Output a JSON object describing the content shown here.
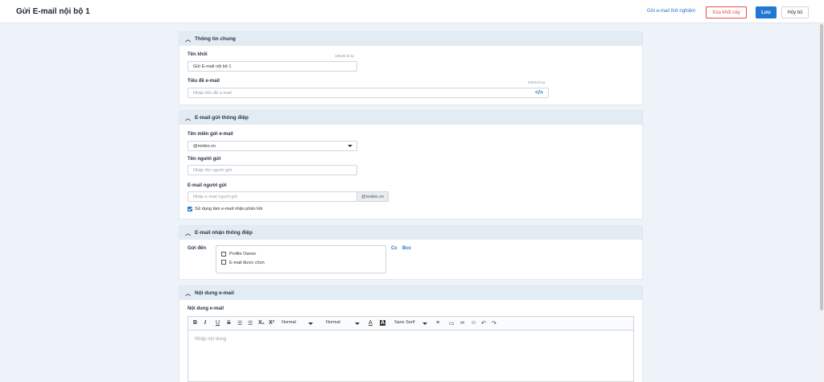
{
  "header": {
    "title": "Gửi E-mail nội bộ 1",
    "test_link": "Gửi e-mail thử nghiệm",
    "delete_label": "Xóa khối này",
    "save_label": "Lưu",
    "cancel_label": "Hủy bỏ"
  },
  "general": {
    "title": "Thông tin chung",
    "name_label": "Tên khối",
    "name_counter": "19/100 kí tự",
    "name_value": "Gửi E-mail nội bộ 1",
    "subject_label": "Tiêu đề e-mail",
    "subject_counter": "0/200 kí tự",
    "subject_placeholder": "Nhập tiêu đề e-mail",
    "code_icon": "</>"
  },
  "sender": {
    "title": "E-mail gửi thông điệp",
    "domain_label": "Tên miền gửi e-mail",
    "domain_value": "@mobio.vn",
    "sender_name_label": "Tên người gửi",
    "sender_name_placeholder": "Nhập tên người gửi",
    "sender_email_label": "E-mail người gửi",
    "sender_email_placeholder": "Nhập e-mail người gửi",
    "sender_email_suffix": "@mobio.vn",
    "reply_label": "Sử dụng làm e-mail nhận phản hồi",
    "reply_checked": true
  },
  "recipient": {
    "title": "E-mail nhận thông điệp",
    "send_to_label": "Gửi đến",
    "options": [
      "Profile Owner",
      "E-mail được chọn"
    ],
    "cc": "Cc",
    "bcc": "Bcc"
  },
  "content": {
    "title": "Nội dung e-mail",
    "content_label": "Nội dung e-mail",
    "placeholder": "Nhập nội dung",
    "toolbar": {
      "bold": "B",
      "italic": "I",
      "underline": "U",
      "strike": "S",
      "ordered_list": "☰",
      "bullet_list": "☰",
      "subscript": "X₂",
      "superscript": "X²",
      "header_select": "Normal",
      "size_select": "Normal",
      "font_color": "A",
      "bg_color": "A",
      "font_select": "Sans Serif",
      "align": "≡",
      "image": "▭",
      "link": "∞",
      "emoji": "☺",
      "undo": "↶",
      "redo": "↷"
    }
  },
  "icons": {
    "chevron": "chevron-up-icon",
    "caret": "caret-down-icon"
  }
}
